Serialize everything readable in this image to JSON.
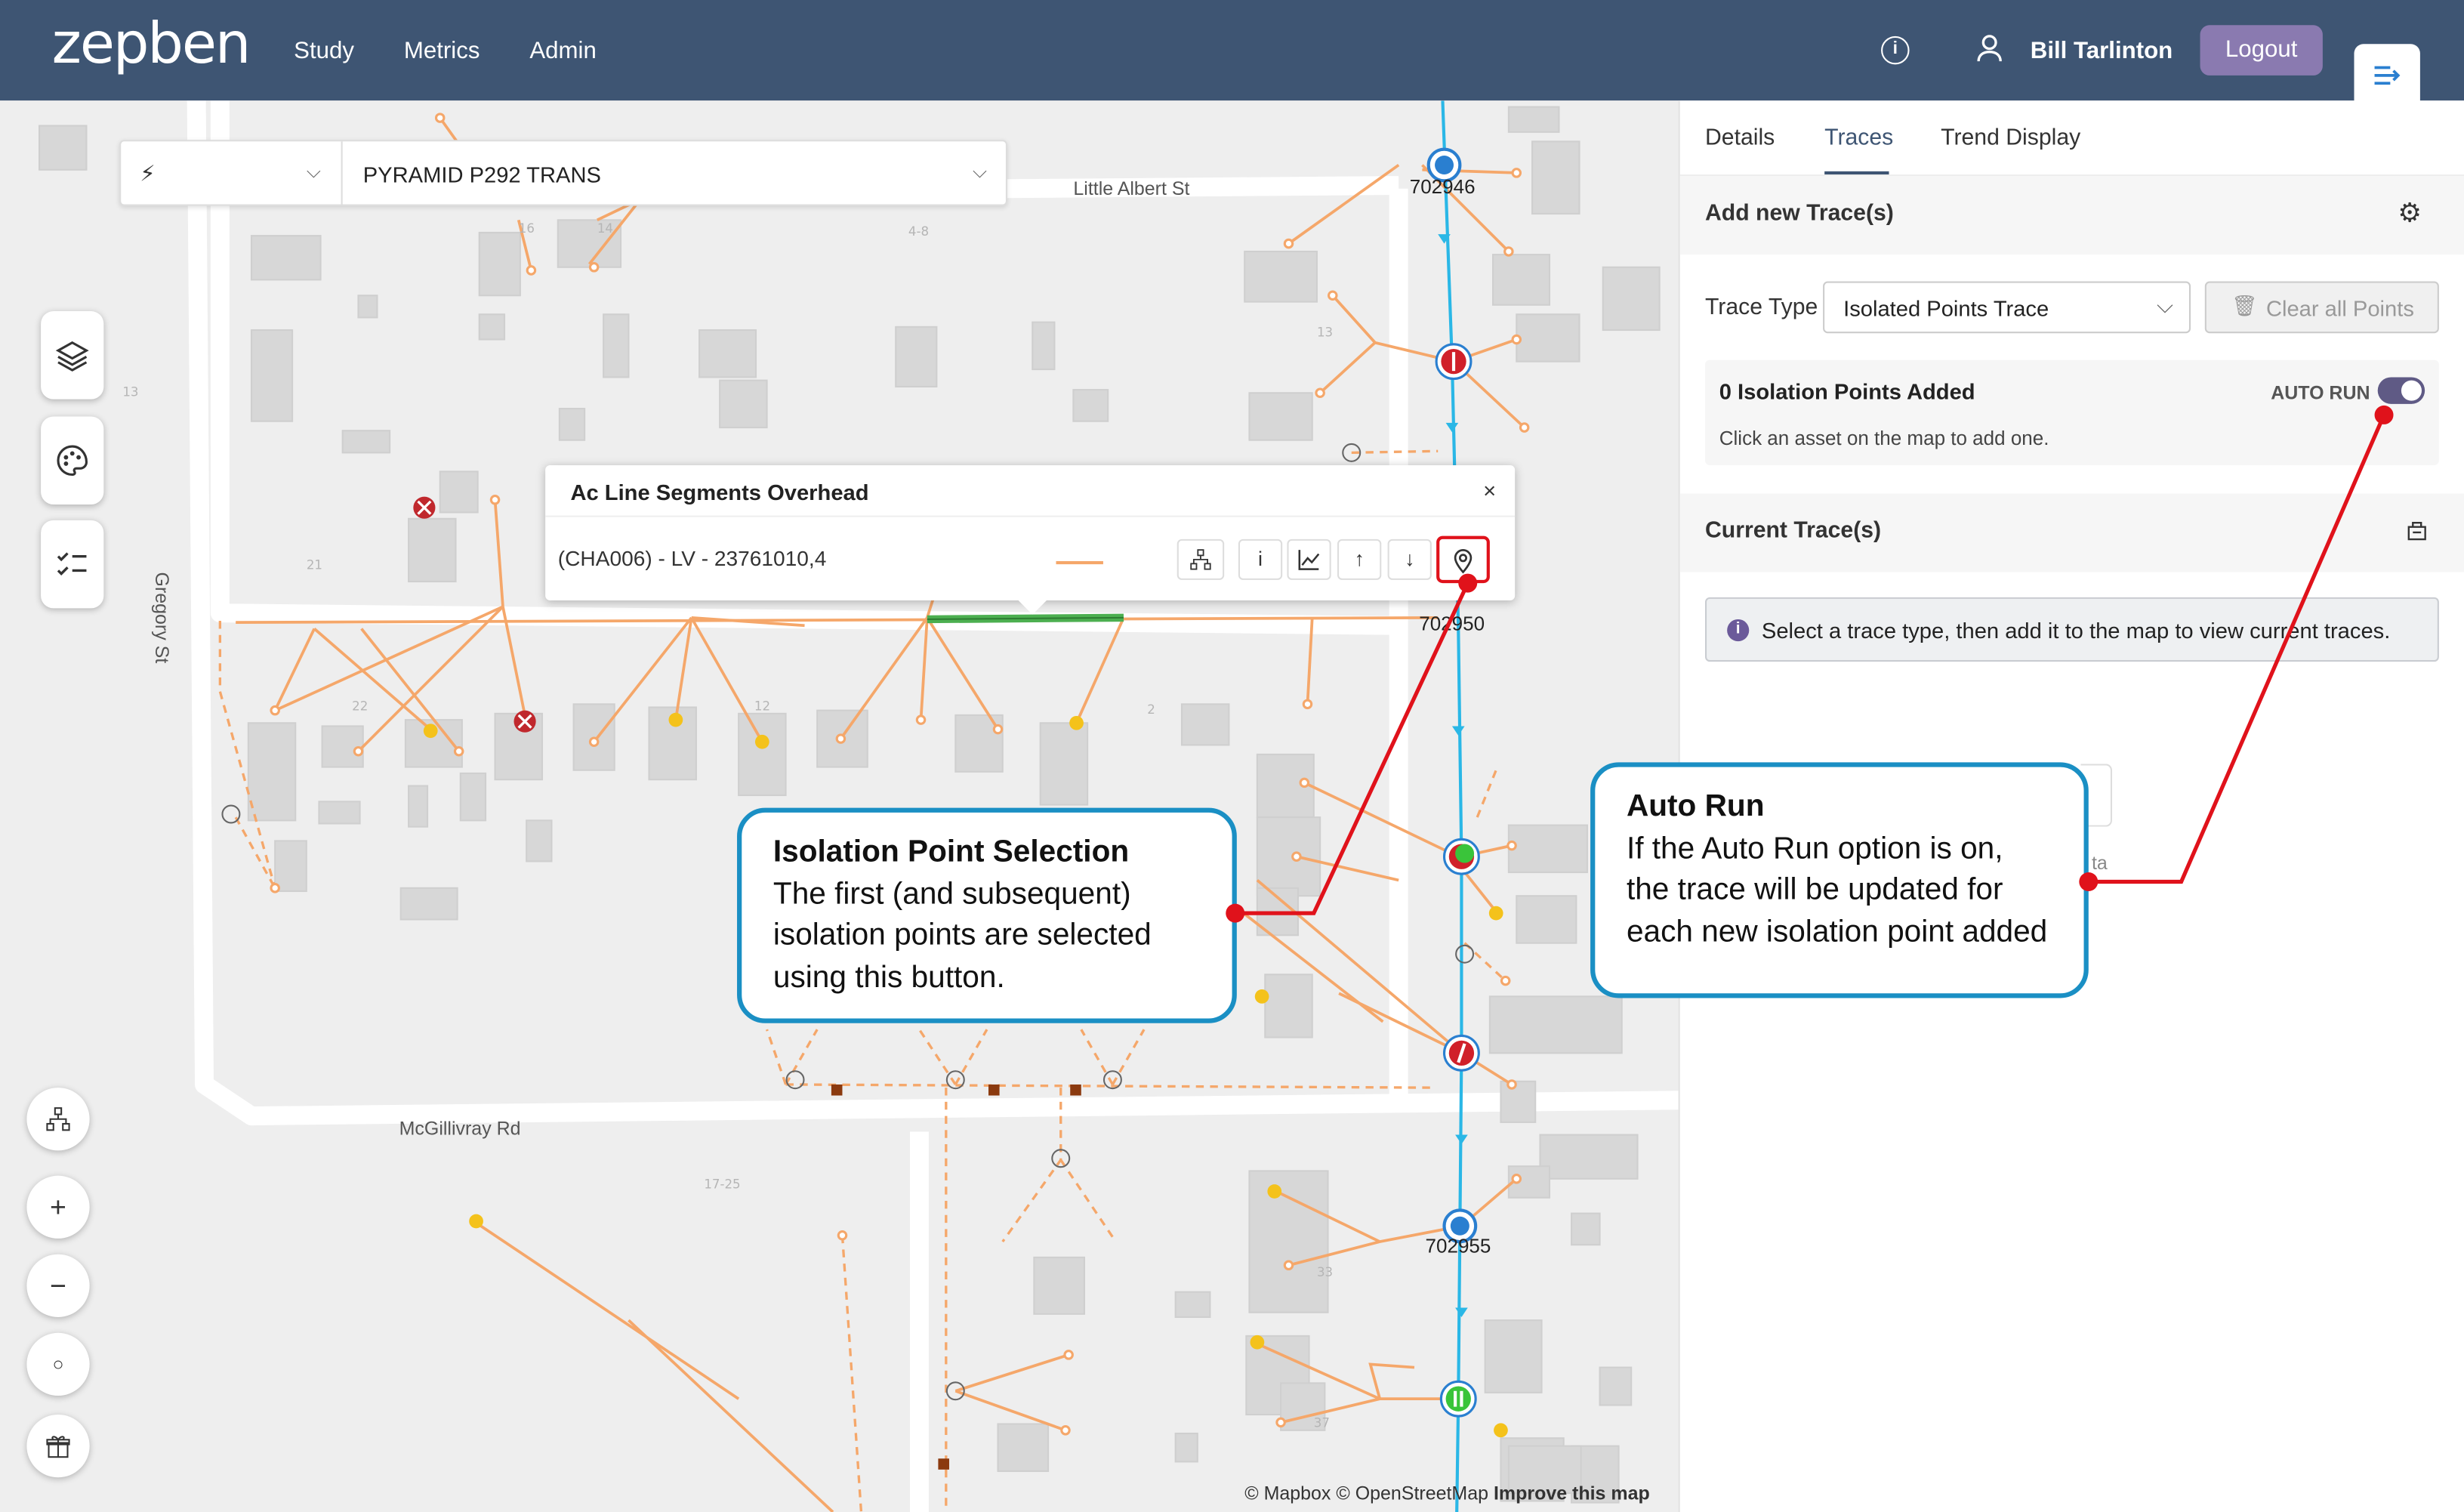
{
  "header": {
    "logo": "zepben",
    "nav": [
      "Study",
      "Metrics",
      "Admin"
    ],
    "user_name": "Bill Tarlinton",
    "logout_label": "Logout",
    "info_icon": "info-icon",
    "collapse_icon": "panel-collapse-icon"
  },
  "search": {
    "icon": "bolt-icon",
    "value": "PYRAMID P292 TRANS"
  },
  "map": {
    "streets": [
      "Little Albert St",
      "Gregory St",
      "McGillivray Rd"
    ],
    "node_labels": [
      "702946",
      "702950",
      "702955"
    ],
    "attribution_main": "© Mapbox © OpenStreetMap",
    "attribution_link": "Improve this map",
    "colors": {
      "lv_line": "#f5a76a",
      "hv_line": "#2ab7e6",
      "selected": "#4caf50",
      "isolated": "#d0202a"
    }
  },
  "map_controls": {
    "left_buttons": [
      "layers-icon",
      "palette-icon",
      "checklist-icon"
    ],
    "bottom_buttons": [
      "network-icon",
      "zoom-in-icon",
      "zoom-out-icon",
      "locate-icon",
      "gift-icon"
    ]
  },
  "popup": {
    "title": "Ac Line Segments Overhead",
    "close": "×",
    "asset": "(CHA006) - LV - 23761010,4",
    "buttons": [
      "hierarchy-icon",
      "info-icon",
      "chart-icon",
      "trace-up-icon",
      "trace-down-icon",
      "isolation-point-icon"
    ]
  },
  "panel": {
    "tabs": [
      "Details",
      "Traces",
      "Trend Display"
    ],
    "active_tab": "Traces",
    "add_title": "Add new Trace(s)",
    "trace_type_label": "Trace Type",
    "trace_type_value": "Isolated Points Trace",
    "clear_label": "Clear all Points",
    "iso_count": "0 Isolation Points Added",
    "iso_hint": "Click an asset on the map to add one.",
    "auto_run_label": "AUTO RUN",
    "auto_run_on": true,
    "current_title": "Current Trace(s)",
    "notice": "Select a trace type, then add it to the map to view current traces.",
    "behind_text": "ta"
  },
  "callouts": {
    "isolation": {
      "heading": "Isolation Point Selection",
      "body": "The first (and subsequent) isolation points are selected using this button."
    },
    "auto_run": {
      "heading": "Auto Run",
      "body": "If the Auto Run option is on, the trace will be updated for each new isolation point added"
    }
  }
}
